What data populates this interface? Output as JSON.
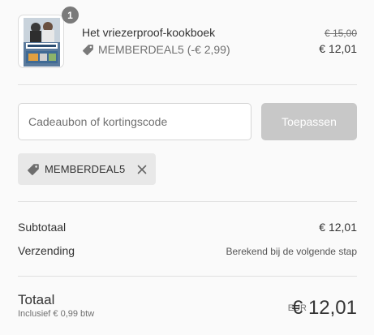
{
  "product": {
    "quantity": "1",
    "title": "Het vriezerproof-kookboek",
    "discount_label": "MEMBERDEAL5 (-€ 2,99)",
    "price_original": "€ 15,00",
    "price_current": "€ 12,01",
    "cover_icon": "book-cover-image"
  },
  "discount_form": {
    "placeholder": "Cadeaubon of kortingscode",
    "value": "",
    "apply_label": "Toepassen"
  },
  "applied_code": {
    "label": "MEMBERDEAL5",
    "tag_icon": "tag-icon",
    "remove_icon": "close-icon"
  },
  "summary": {
    "subtotal_label": "Subtotaal",
    "subtotal_value": "€ 12,01",
    "shipping_label": "Verzending",
    "shipping_value": "Berekend bij de volgende stap"
  },
  "total": {
    "label": "Totaal",
    "tax_note": "Inclusief € 0,99 btw",
    "currency": "EUR",
    "value": "€ 12,01"
  },
  "colors": {
    "background": "#fafafa",
    "badge": "#7a7a7a",
    "button_disabled": "#c8c8c8",
    "chip": "#e8e8e8",
    "divider": "#e1e1e1"
  }
}
